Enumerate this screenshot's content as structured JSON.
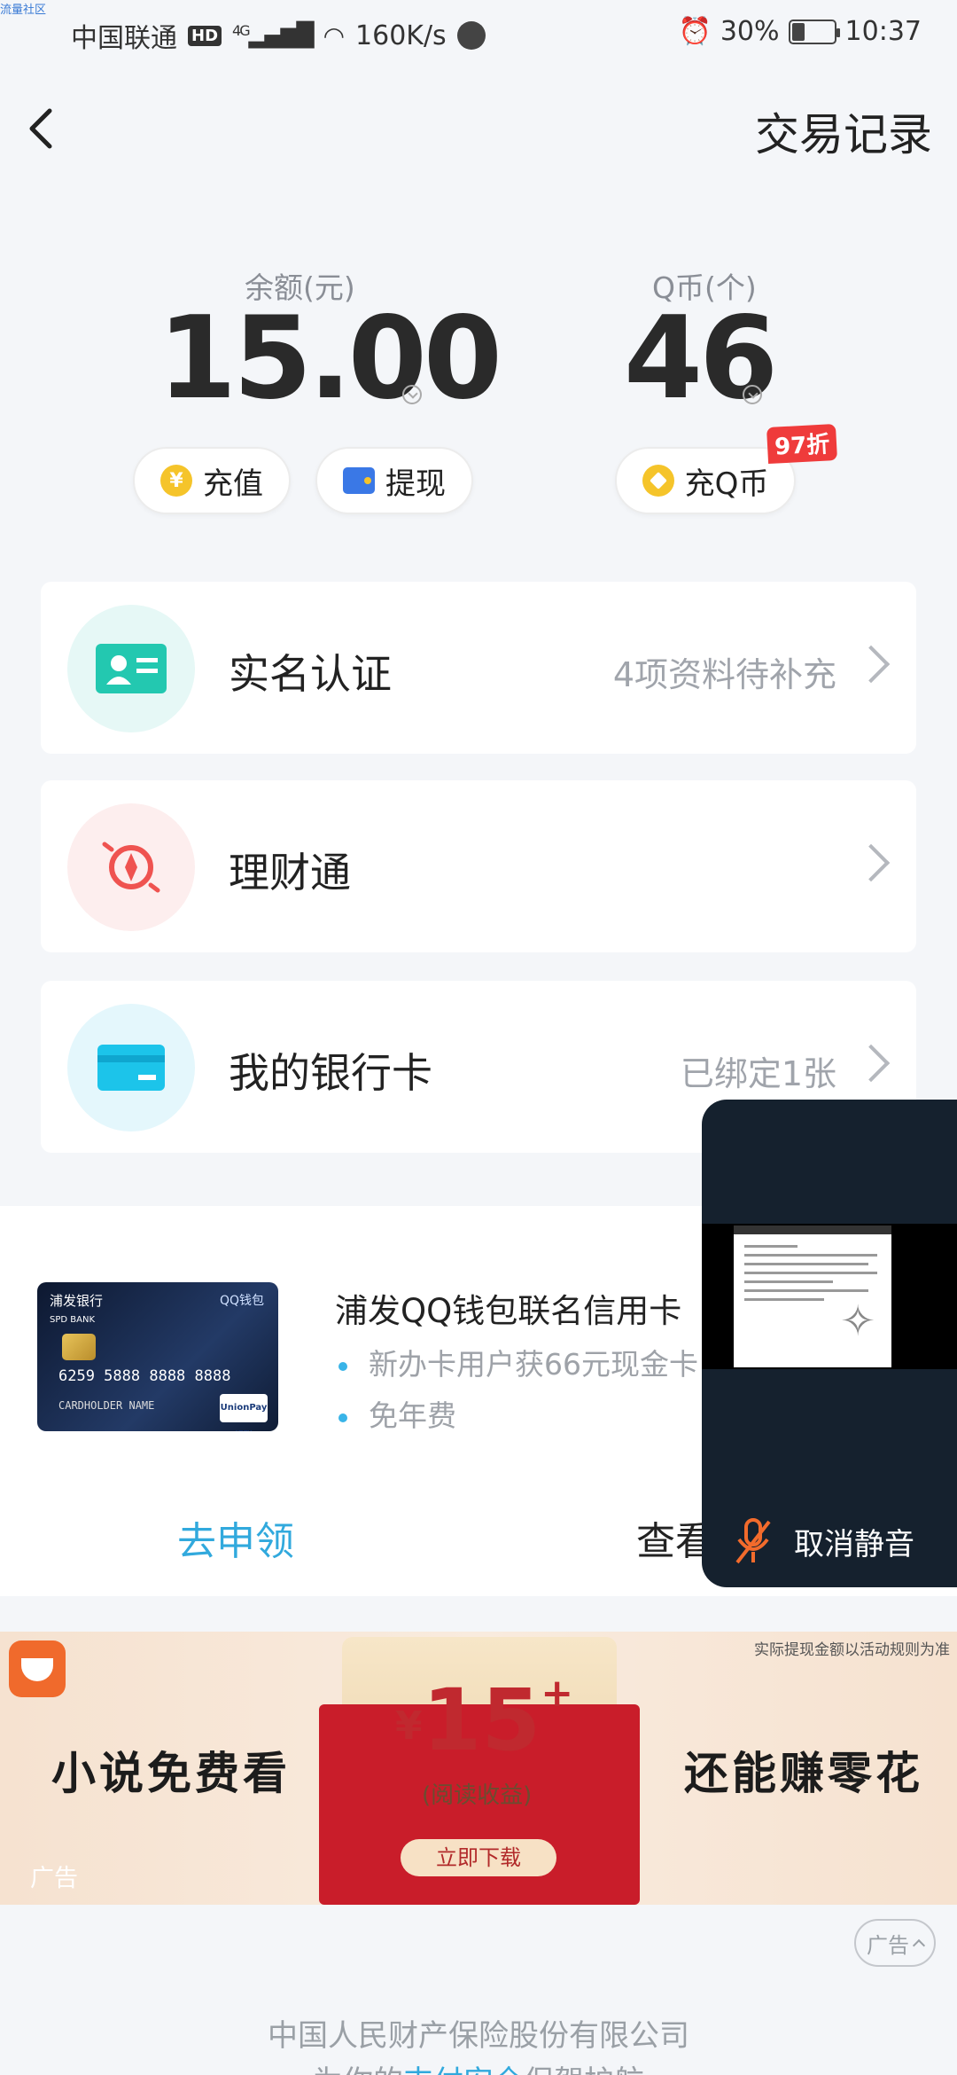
{
  "corner_tag": "流量社区",
  "status_bar": {
    "carrier": "中国联通",
    "hd": "HD",
    "network": "4G",
    "speed": "160K/s",
    "battery": "30%",
    "battery_level": 0.3,
    "time": "10:37"
  },
  "nav": {
    "title": "交易记录"
  },
  "balance": {
    "label": "余额(元)",
    "value": "15.00"
  },
  "qcoin": {
    "label": "Q币(个)",
    "value": "46"
  },
  "actions": {
    "recharge": "充值",
    "recharge_icon": "¥",
    "withdraw": "提现",
    "recharge_qcoin": "充Q币",
    "discount_badge": "97折"
  },
  "menu": [
    {
      "label": "实名认证",
      "value": "4项资料待补充",
      "icon": "id-card-icon"
    },
    {
      "label": "理财通",
      "value": "",
      "icon": "wealth-icon"
    },
    {
      "label": "我的银行卡",
      "value": "已绑定1张",
      "icon": "bank-card-icon"
    }
  ],
  "promo": {
    "title": "浦发QQ钱包联名信用卡",
    "bullets": [
      "新办卡用户获66元现金卡",
      "免年费"
    ],
    "apply": "去申领",
    "view": "查看",
    "card": {
      "bank": "浦发银行",
      "bank_en": "SPD BANK",
      "brand": "QQ钱包",
      "number": "6259 5888 8888 8888",
      "holder": "CARDHOLDER NAME",
      "network": "UnionPay 银联"
    }
  },
  "floating_video": {
    "unmute_label": "取消静音"
  },
  "ad": {
    "notice": "实际提现金额以活动规则为准",
    "left_text": "小说免费看",
    "right_text": "还能赚零花",
    "currency": "¥",
    "amount": "15",
    "plus": "+",
    "subtitle": "(阅读收益)",
    "download": "立即下载",
    "tag": "广告"
  },
  "footer": {
    "ad_pill": "广告",
    "company": "中国人民财产保险股份有限公司",
    "line2_pre": "为你的",
    "line2_highlight": "支付安全",
    "line2_post": "保驾护航"
  }
}
